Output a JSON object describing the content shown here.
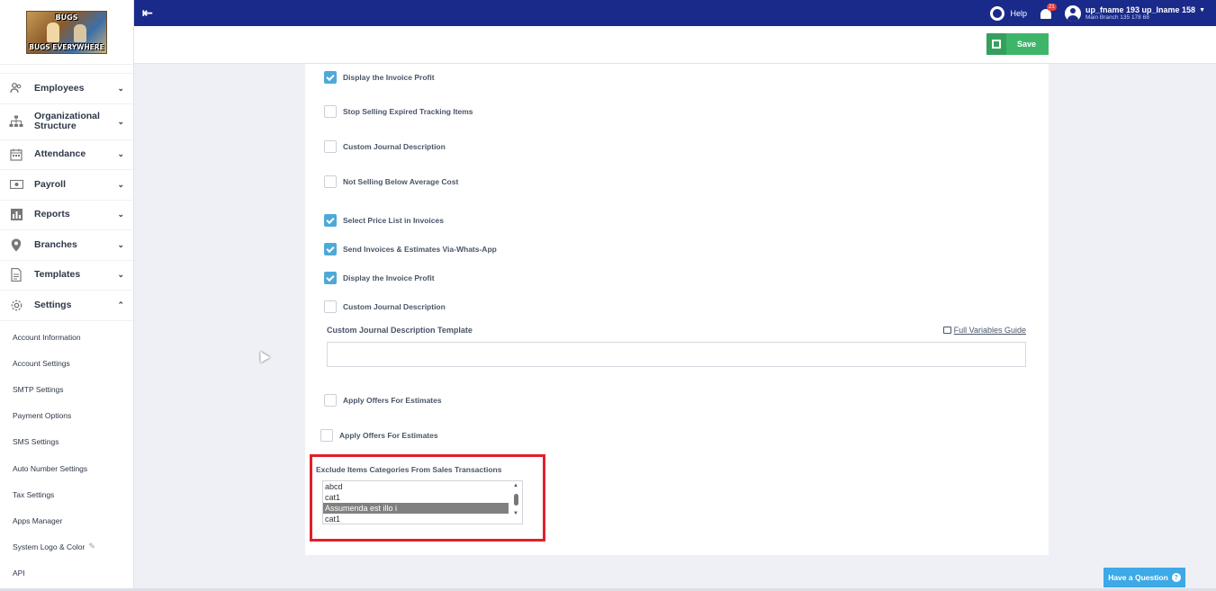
{
  "logo": {
    "top_text": "BUGS",
    "bottom_text": "BUGS EVERYWHERE"
  },
  "topbar": {
    "help_label": "Help",
    "notification_count": "21",
    "user_name": "up_fname 193 up_lname 158",
    "user_branch": "Main Branch 135 178 68"
  },
  "actionbar": {
    "save_label": "Save"
  },
  "sidebar": {
    "items": [
      {
        "label": "Employees",
        "icon": "users-icon",
        "expanded": false
      },
      {
        "label": "Organizational Structure",
        "icon": "org-chart-icon",
        "expanded": false
      },
      {
        "label": "Attendance",
        "icon": "calendar-icon",
        "expanded": false
      },
      {
        "label": "Payroll",
        "icon": "money-icon",
        "expanded": false
      },
      {
        "label": "Reports",
        "icon": "bar-chart-icon",
        "expanded": false
      },
      {
        "label": "Branches",
        "icon": "location-pin-icon",
        "expanded": false
      },
      {
        "label": "Templates",
        "icon": "document-icon",
        "expanded": false
      },
      {
        "label": "Settings",
        "icon": "gear-icon",
        "expanded": true
      }
    ],
    "settings_sub": [
      "Account Information",
      "Account Settings",
      "SMTP Settings",
      "Payment Options",
      "SMS Settings",
      "Auto Number Settings",
      "Tax Settings",
      "Apps Manager",
      "System Logo & Color",
      "API"
    ]
  },
  "settings_form": {
    "checkboxes": [
      {
        "label": "Display the Invoice Profit",
        "checked": true
      },
      {
        "label": "Stop Selling Expired Tracking Items",
        "checked": false
      },
      {
        "label": "Custom Journal Description",
        "checked": false
      },
      {
        "label": "Not Selling Below Average Cost",
        "checked": false
      },
      {
        "label": "Select Price List in Invoices",
        "checked": true
      },
      {
        "label": "Send Invoices & Estimates Via-Whats-App",
        "checked": true
      },
      {
        "label": "Display the Invoice Profit",
        "checked": true
      },
      {
        "label": "Custom Journal Description",
        "checked": false
      },
      {
        "label": "Apply Offers For Estimates",
        "checked": false
      },
      {
        "label": "Apply Offers For Estimates",
        "checked": false
      }
    ],
    "custom_journal_template_label": "Custom Journal Description Template",
    "full_variables_guide": "Full Variables Guide",
    "custom_journal_template_value": "",
    "exclude_categories_label": "Exclude Items Categories From Sales Transactions",
    "exclude_categories_options": [
      {
        "label": "abcd",
        "selected": false
      },
      {
        "label": "cat1",
        "selected": false
      },
      {
        "label": "Assumenda est illo i",
        "selected": true
      },
      {
        "label": "cat1",
        "selected": false
      }
    ]
  },
  "help_widget": {
    "label": "Have a Question"
  },
  "colors": {
    "topbar": "#1a2a8a",
    "save_button": "#3fb56a",
    "checkbox_checked": "#4fa9d8",
    "highlight_box": "#e0202a",
    "help_widget": "#3da9e6"
  }
}
